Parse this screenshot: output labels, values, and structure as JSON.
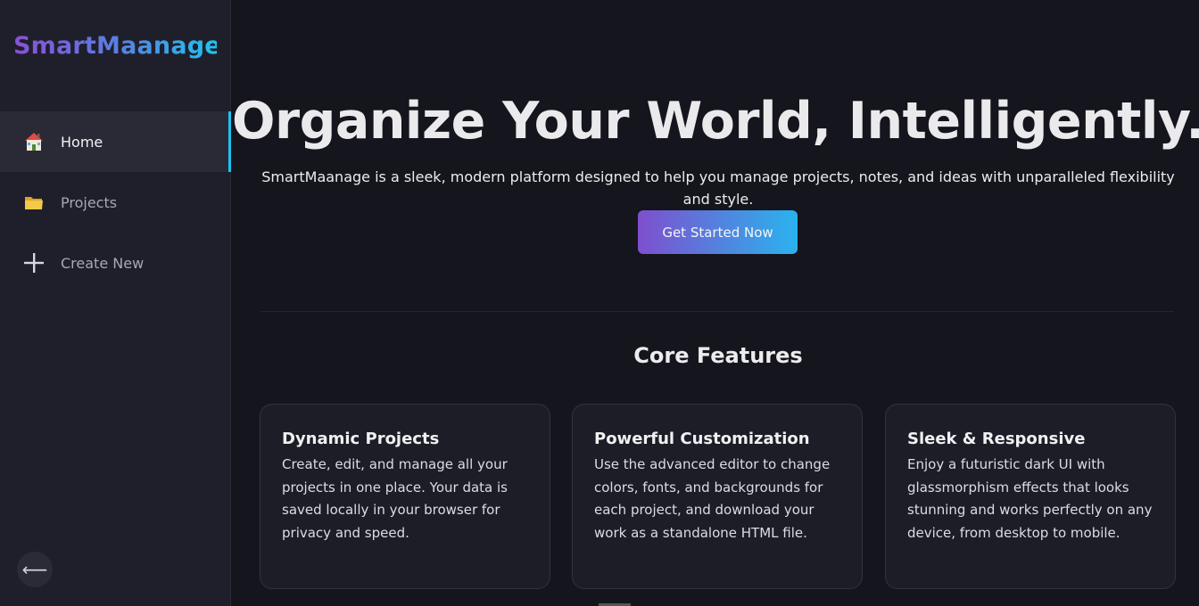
{
  "sidebar": {
    "logo": "SmartMaanage",
    "items": [
      {
        "label": "Home",
        "icon": "home-icon",
        "active": true
      },
      {
        "label": "Projects",
        "icon": "folder-icon",
        "active": false
      },
      {
        "label": "Create New",
        "icon": "plus-icon",
        "active": false
      }
    ],
    "collapse_glyph": "⟵"
  },
  "hero": {
    "title": "Organize Your World, Intelligently.",
    "subtitle": "SmartMaanage is a sleek, modern platform designed to help you manage projects, notes, and ideas with unparalleled flexibility and style.",
    "cta_label": "Get Started Now"
  },
  "features": {
    "title": "Core Features",
    "cards": [
      {
        "title": "Dynamic Projects",
        "text": "Create, edit, and manage all your projects in one place. Your data is saved locally in your browser for privacy and speed."
      },
      {
        "title": "Powerful Customization",
        "text": "Use the advanced editor to change colors, fonts, and backgrounds for each project, and download your work as a standalone HTML file."
      },
      {
        "title": "Sleek & Responsive",
        "text": "Enjoy a futuristic dark UI with glassmorphism effects that looks stunning and works perfectly on any device, from desktop to mobile."
      }
    ]
  },
  "colors": {
    "background": "#15151d",
    "sidebar": "#1f1f2b",
    "accent_start": "#7e4fce",
    "accent_end": "#1ec3f0"
  }
}
